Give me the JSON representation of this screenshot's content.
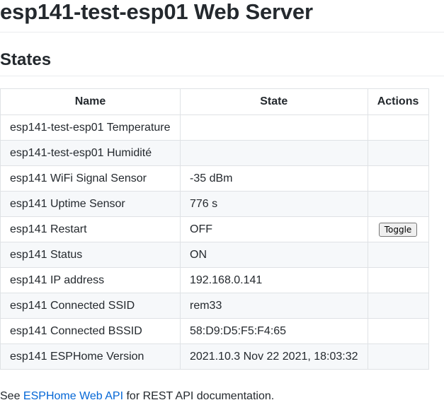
{
  "page": {
    "title": "esp141-test-esp01 Web Server",
    "section_title": "States"
  },
  "table": {
    "headers": [
      "Name",
      "State",
      "Actions"
    ],
    "rows": [
      {
        "name": "esp141-test-esp01 Temperature",
        "state": "",
        "action": ""
      },
      {
        "name": "esp141-test-esp01 Humidité",
        "state": "",
        "action": ""
      },
      {
        "name": "esp141 WiFi Signal Sensor",
        "state": "-35 dBm",
        "action": ""
      },
      {
        "name": "esp141 Uptime Sensor",
        "state": "776 s",
        "action": ""
      },
      {
        "name": "esp141 Restart",
        "state": "OFF",
        "action": "Toggle"
      },
      {
        "name": "esp141 Status",
        "state": "ON",
        "action": ""
      },
      {
        "name": "esp141 IP address",
        "state": "192.168.0.141",
        "action": ""
      },
      {
        "name": "esp141 Connected SSID",
        "state": "rem33",
        "action": ""
      },
      {
        "name": "esp141 Connected BSSID",
        "state": "58:D9:D5:F5:F4:65",
        "action": ""
      },
      {
        "name": "esp141 ESPHome Version",
        "state": "2021.10.3 Nov 22 2021, 18:03:32",
        "action": ""
      }
    ]
  },
  "footer": {
    "prefix": "See ",
    "link_text": "ESPHome Web API",
    "suffix": " for REST API documentation."
  },
  "colors": {
    "link": "#0366d6",
    "stripe": "#f6f8fa",
    "border": "#dfe2e5"
  }
}
